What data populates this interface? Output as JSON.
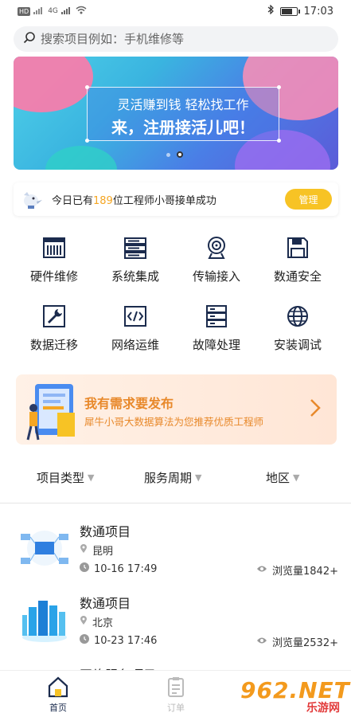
{
  "status_bar": {
    "left_badges": [
      "HD",
      "4G",
      "4G"
    ],
    "time": "17:03",
    "battery_level": 0.8
  },
  "search": {
    "placeholder": "搜索项目例如：手机维修等"
  },
  "banner": {
    "line1": "灵活赚到钱 轻松找工作",
    "line2": "来，注册接活儿吧！",
    "slide_count": 2,
    "active_slide": 2
  },
  "notice": {
    "prefix": "今日已有",
    "count": "189",
    "suffix": "位工程师小哥接单成功",
    "button": "管理"
  },
  "categories": [
    {
      "label": "硬件维修",
      "icon": "hardware-icon"
    },
    {
      "label": "系统集成",
      "icon": "server-rack-icon"
    },
    {
      "label": "传输接入",
      "icon": "webcam-icon"
    },
    {
      "label": "数通安全",
      "icon": "save-disk-icon"
    },
    {
      "label": "数据迁移",
      "icon": "wrench-icon"
    },
    {
      "label": "网络运维",
      "icon": "code-icon"
    },
    {
      "label": "故障处理",
      "icon": "server-stack-icon"
    },
    {
      "label": "安装调试",
      "icon": "globe-icon"
    }
  ],
  "promo": {
    "title": "我有需求要发布",
    "subtitle": "犀牛小哥大数据算法为您推荐优质工程师"
  },
  "filters": [
    {
      "label": "项目类型"
    },
    {
      "label": "服务周期"
    },
    {
      "label": "地区"
    }
  ],
  "projects": [
    {
      "name": "数通项目",
      "location": "昆明",
      "time": "10-16 17:49",
      "views": "浏览量1842+"
    },
    {
      "name": "数通项目",
      "location": "北京",
      "time": "10-23 17:46",
      "views": "浏览量2532+"
    },
    {
      "name": "网络服务项目"
    }
  ],
  "tabbar": [
    {
      "label": "首页",
      "active": true
    },
    {
      "label": "订单",
      "active": false
    }
  ],
  "watermark": {
    "big": "962.NET",
    "small": "乐游网"
  },
  "colors": {
    "accent": "#f7c325",
    "promo_text": "#e8892b",
    "count_highlight": "#f5a623"
  }
}
